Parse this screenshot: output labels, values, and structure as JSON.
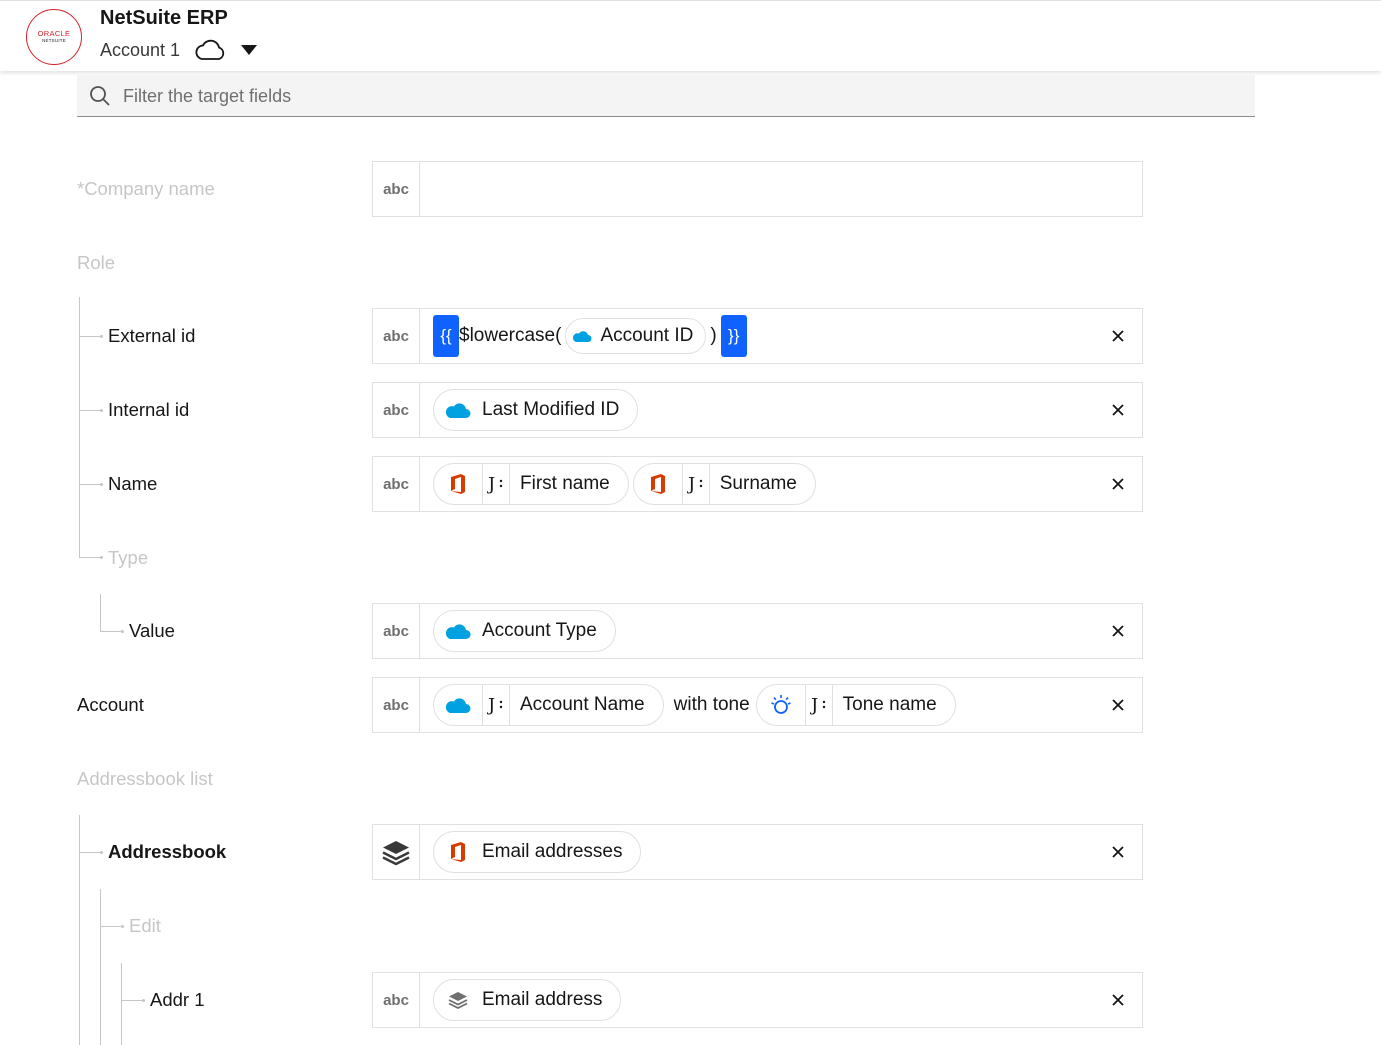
{
  "header": {
    "logo_line1": "ORACLE",
    "logo_line2": "NETSUITE",
    "app_title": "NetSuite ERP",
    "account": "Account 1"
  },
  "search": {
    "placeholder": "Filter the target fields"
  },
  "colors": {
    "brace": "#0f62fe",
    "oracle_red": "#d1232a",
    "salesforce_blue": "#00a1e0",
    "office_red": "#d83b01",
    "muted": "#c6c6c6"
  },
  "type_abc": "abc",
  "labels": {
    "company_name": "*Company name",
    "role": "Role",
    "external_id": "External id",
    "internal_id": "Internal id",
    "name": "Name",
    "type": "Type",
    "value": "Value",
    "account": "Account",
    "addressbook_list": "Addressbook list",
    "addressbook": "Addressbook",
    "edit": "Edit",
    "addr1": "Addr 1"
  },
  "fields": {
    "external_id": {
      "open_brace": "{{",
      "function": "$lowercase(",
      "chip": "Account ID",
      "close_paren": ")",
      "close_brace": "}}"
    },
    "internal_id": {
      "chip": "Last Modified ID"
    },
    "name": {
      "chip1": "First name",
      "chip2": "Surname"
    },
    "value": {
      "chip": "Account Type"
    },
    "account": {
      "chip1": "Account Name",
      "joiner": "with tone",
      "chip2": "Tone name"
    },
    "addressbook": {
      "chip": "Email addresses"
    },
    "addr1": {
      "chip": "Email address"
    }
  }
}
